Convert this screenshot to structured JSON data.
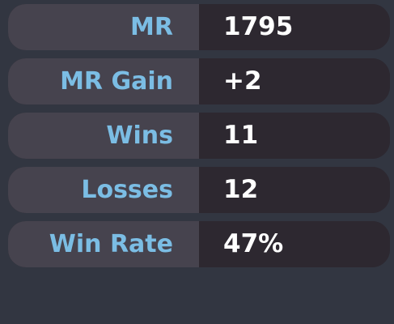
{
  "stats": [
    {
      "label": "MR",
      "value": "1795"
    },
    {
      "label": "MR Gain",
      "value": "+2"
    },
    {
      "label": "Wins",
      "value": "11"
    },
    {
      "label": "Losses",
      "value": "12"
    },
    {
      "label": "Win Rate",
      "value": "47%"
    }
  ],
  "colors": {
    "background": "#323641",
    "label_bg": "#46434e",
    "value_bg": "#2d2830",
    "label_text": "#7bbde4",
    "value_text": "#ffffff"
  }
}
